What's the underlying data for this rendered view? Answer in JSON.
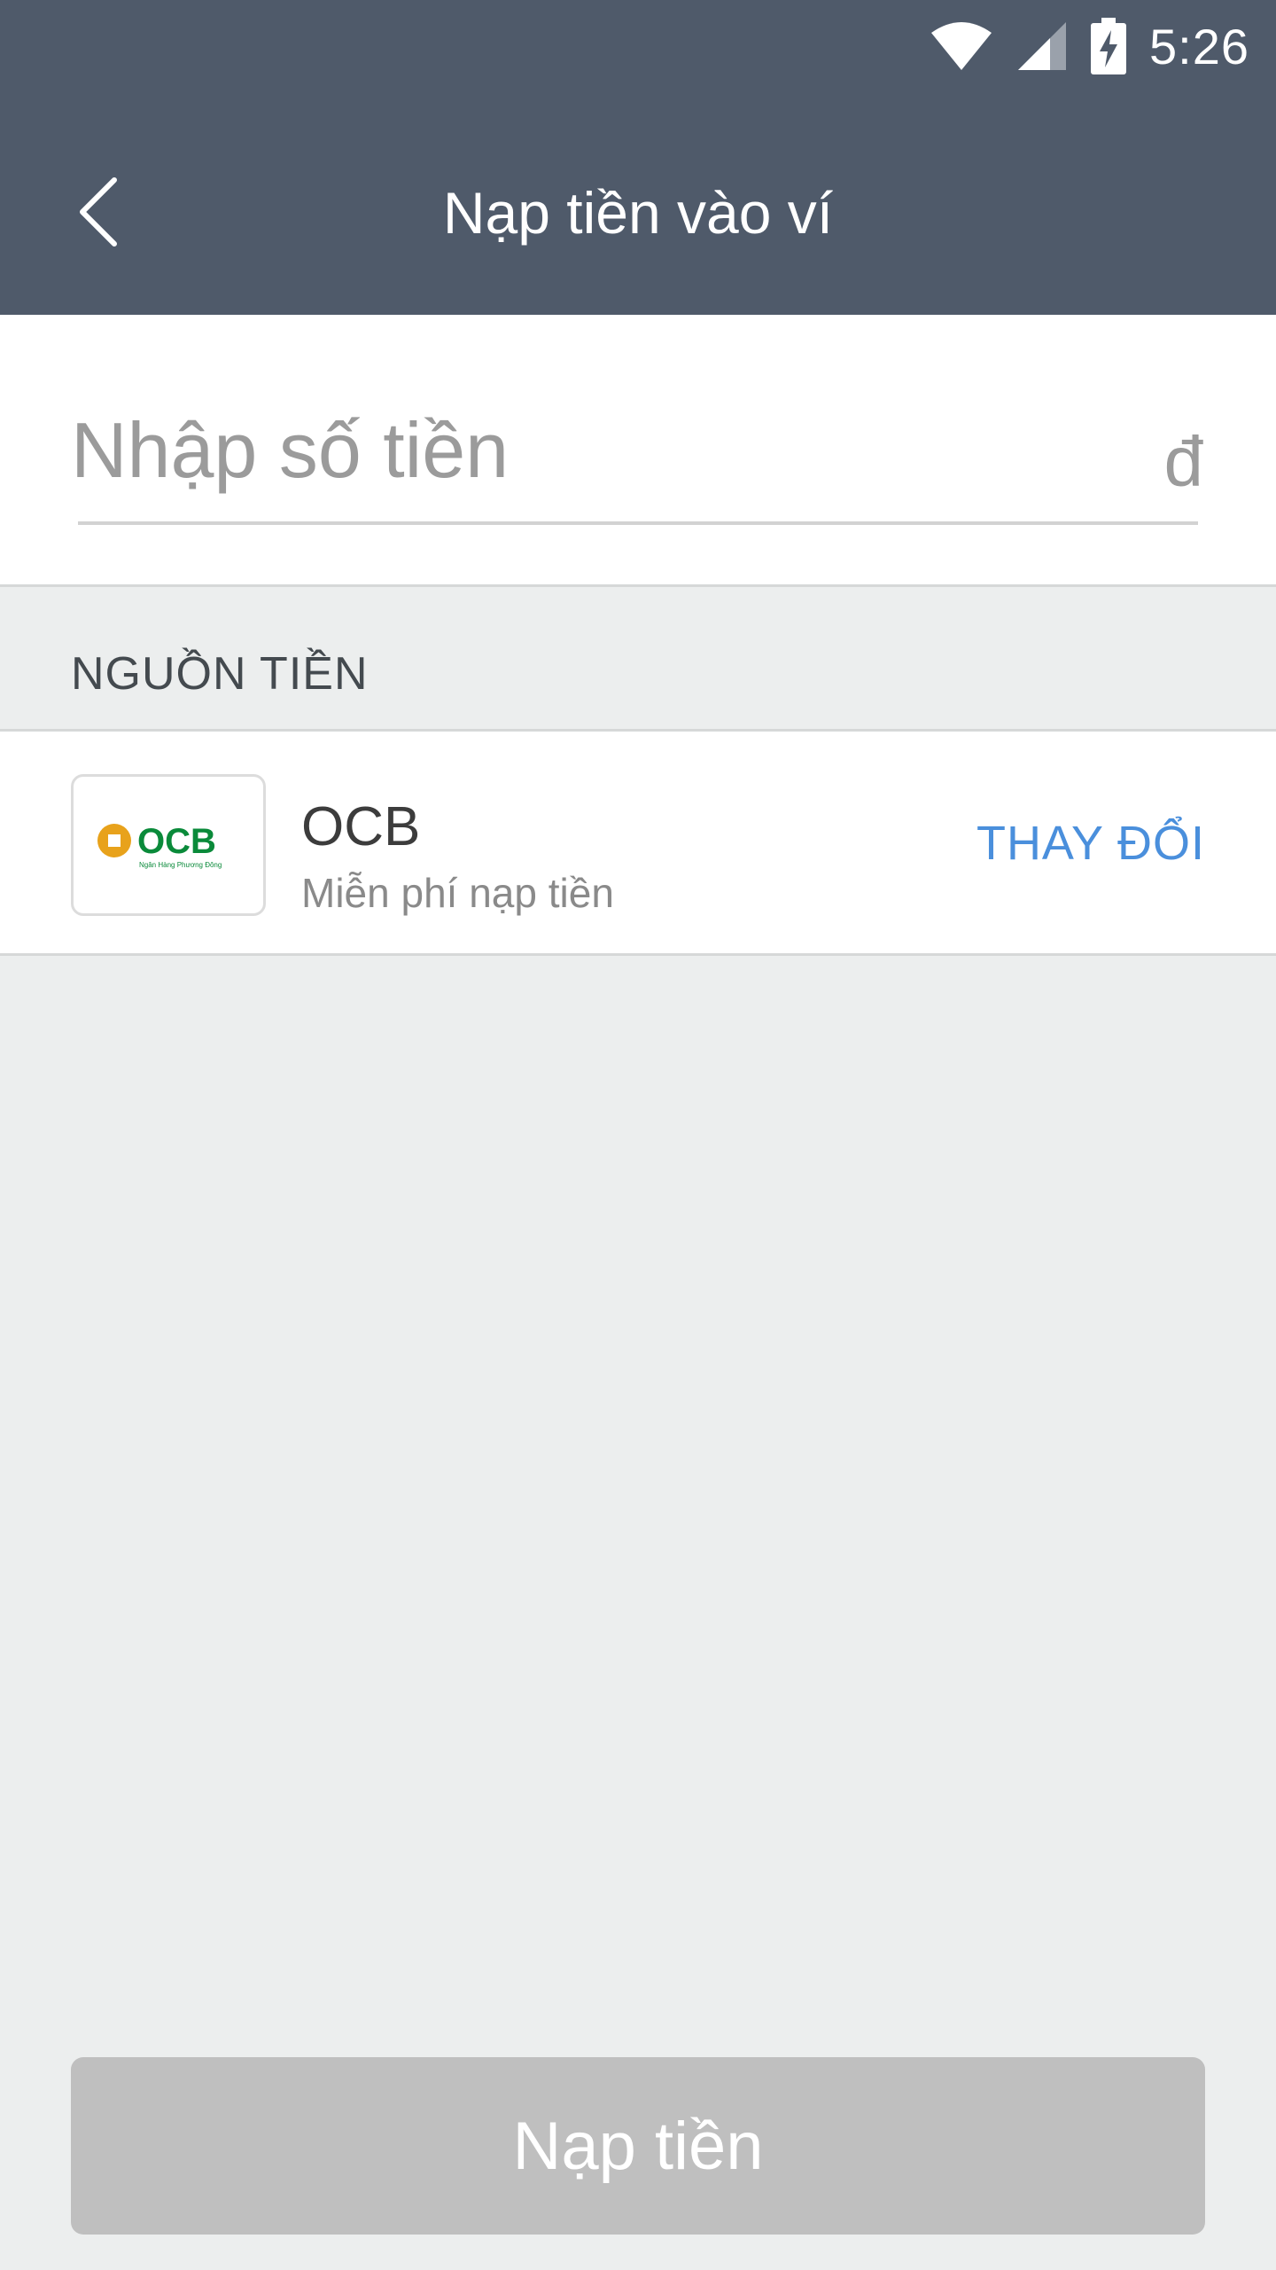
{
  "status_bar": {
    "time": "5:26",
    "icons": [
      "wifi-icon",
      "cell-signal-icon",
      "battery-charging-icon"
    ]
  },
  "header": {
    "back_icon": "chevron-left-icon",
    "title": "Nạp tiền vào ví",
    "background_color": "#4f5a6a"
  },
  "amount": {
    "placeholder": "Nhập số tiền",
    "value": "",
    "currency_symbol": "đ"
  },
  "source": {
    "section_label": "NGUỒN TIỀN",
    "bank": {
      "logo_text": "OCB",
      "logo_subtext": "Ngân Hàng Phương Đông",
      "name": "OCB",
      "description": "Miễn phí nạp tiền"
    },
    "change_label": "THAY ĐỔI",
    "accent_color": "#4a8fdc"
  },
  "submit": {
    "label": "Nạp tiền",
    "enabled": false
  }
}
